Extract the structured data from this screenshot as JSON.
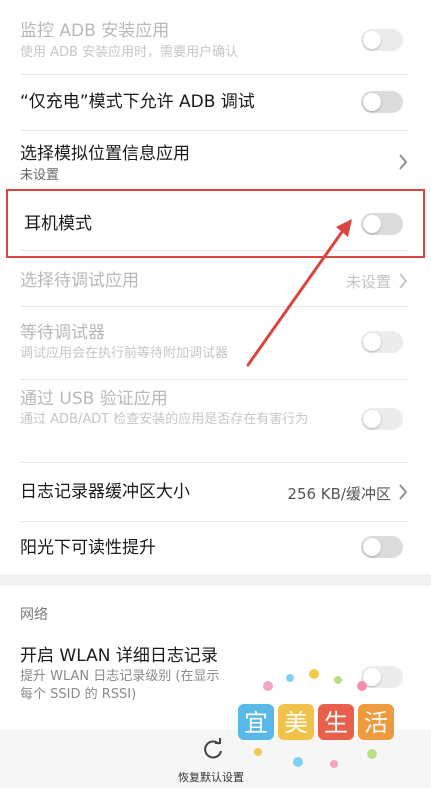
{
  "settings": {
    "rows": [
      {
        "title": "监控 ADB 安装应用",
        "subtitle": "使用 ADB 安装应用时，需要用户确认",
        "control": "toggle",
        "state": "off",
        "enabled": false
      },
      {
        "title": "“仅充电”模式下允许 ADB 调试",
        "control": "toggle",
        "state": "off",
        "enabled": true
      },
      {
        "title": "选择模拟位置信息应用",
        "subtitle": "未设置",
        "control": "chevron",
        "enabled": true
      },
      {
        "title": "耳机模式",
        "control": "toggle",
        "state": "off",
        "enabled": true,
        "highlighted": true
      },
      {
        "title": "选择待调试应用",
        "value": "未设置",
        "control": "chevron",
        "enabled": false
      },
      {
        "title": "等待调试器",
        "subtitle": "调试应用会在执行前等待附加调试器",
        "control": "toggle",
        "state": "off",
        "enabled": false
      },
      {
        "title": "通过 USB 验证应用",
        "subtitle": "通过 ADB/ADT 检查安装的应用是否存在有害行为",
        "control": "toggle",
        "state": "off",
        "enabled": false
      },
      {
        "title": "日志记录器缓冲区大小",
        "value": "256 KB/缓冲区",
        "control": "chevron",
        "enabled": true
      },
      {
        "title": "阳光下可读性提升",
        "control": "toggle",
        "state": "off",
        "enabled": true
      }
    ],
    "network": {
      "section_label": "网络",
      "wlan_title": "开启 WLAN 详细日志记录",
      "wlan_subtitle": "提升 WLAN 日志记录级别 (在显示每个 SSID 的 RSSI)"
    }
  },
  "bottom": {
    "restore_label": "恢复默认设置"
  },
  "watermark": {
    "text": "宜美生活"
  },
  "colors": {
    "highlight": "#d9463f",
    "toggle_off": "#dcdcdc",
    "disabled_text": "#b9b9b9"
  }
}
